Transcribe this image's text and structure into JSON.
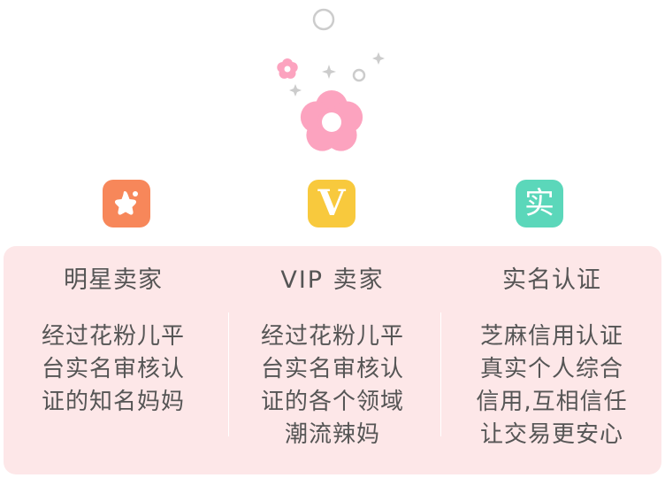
{
  "features": [
    {
      "icon": "star-icon",
      "color": "#f7875a",
      "title": "明星卖家",
      "lines": [
        "经过花粉儿平",
        "台实名审核认",
        "证的知名妈妈"
      ]
    },
    {
      "icon": "vip-v-icon",
      "glyph": "V",
      "color": "#f8c93d",
      "title": "VIP 卖家",
      "lines": [
        "经过花粉儿平",
        "台实名审核认",
        "证的各个领域",
        "潮流辣妈"
      ]
    },
    {
      "icon": "real-name-icon",
      "glyph": "实",
      "color": "#5bd7ba",
      "title": "实名认证",
      "lines": [
        "芝麻信用认证",
        "真实个人综合",
        "信用,互相信任",
        "让交易更安心"
      ]
    }
  ],
  "colors": {
    "panel": "#fde7e8",
    "flower": "#fca3bf",
    "text": "#555555",
    "sparkle": "#c8c8c8"
  }
}
